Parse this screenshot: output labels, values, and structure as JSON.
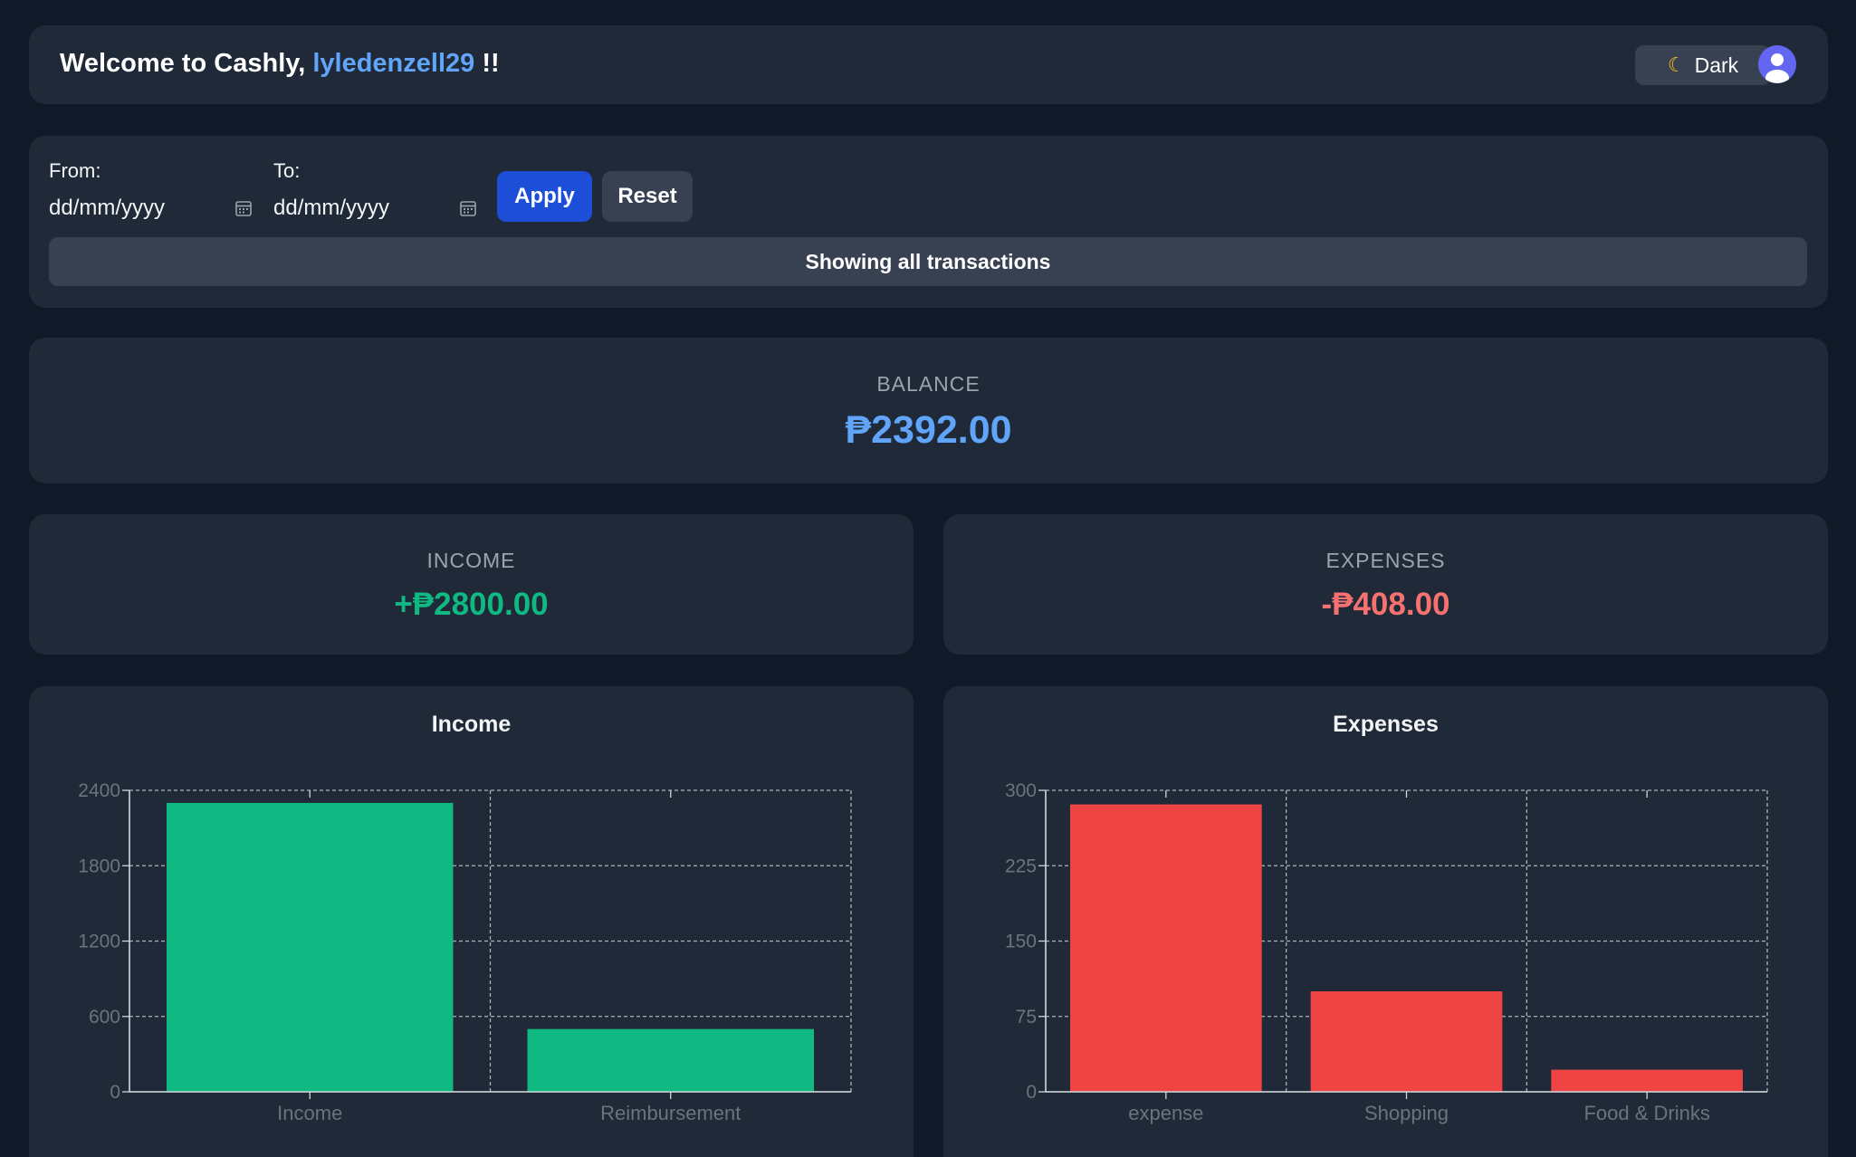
{
  "header": {
    "welcome_prefix": "Welcome to Cashly, ",
    "username": "lyledenzell29",
    "welcome_suffix": " !!",
    "theme_label": "Dark",
    "theme_icon": "moon-icon",
    "avatar_icon": "user-avatar-icon"
  },
  "filter": {
    "from_label": "From:",
    "to_label": "To:",
    "from_placeholder": "dd/mm/yyyy",
    "to_placeholder": "dd/mm/yyyy",
    "apply_label": "Apply",
    "reset_label": "Reset",
    "status": "Showing all transactions"
  },
  "summary": {
    "balance_label": "BALANCE",
    "balance_value": "₱2392.00",
    "income_label": "INCOME",
    "income_value": "+₱2800.00",
    "expenses_label": "EXPENSES",
    "expenses_value": "-₱408.00"
  },
  "colors": {
    "accent_blue": "#60a5fa",
    "income_green": "#10b981",
    "expense_red": "#ef4444",
    "apply_button": "#1d4ed8"
  },
  "chart_data": [
    {
      "type": "bar",
      "title": "Income",
      "categories": [
        "Income",
        "Reimbursement"
      ],
      "values": [
        2300,
        500
      ],
      "ylim": [
        0,
        2400
      ],
      "yticks": [
        0,
        600,
        1200,
        1800,
        2400
      ],
      "color": "#10b981",
      "grid": true
    },
    {
      "type": "bar",
      "title": "Expenses",
      "categories": [
        "expense",
        "Shopping",
        "Food & Drinks"
      ],
      "values": [
        286,
        100,
        22
      ],
      "ylim": [
        0,
        300
      ],
      "yticks": [
        0,
        75,
        150,
        225,
        300
      ],
      "color": "#ef4444",
      "grid": true
    }
  ]
}
